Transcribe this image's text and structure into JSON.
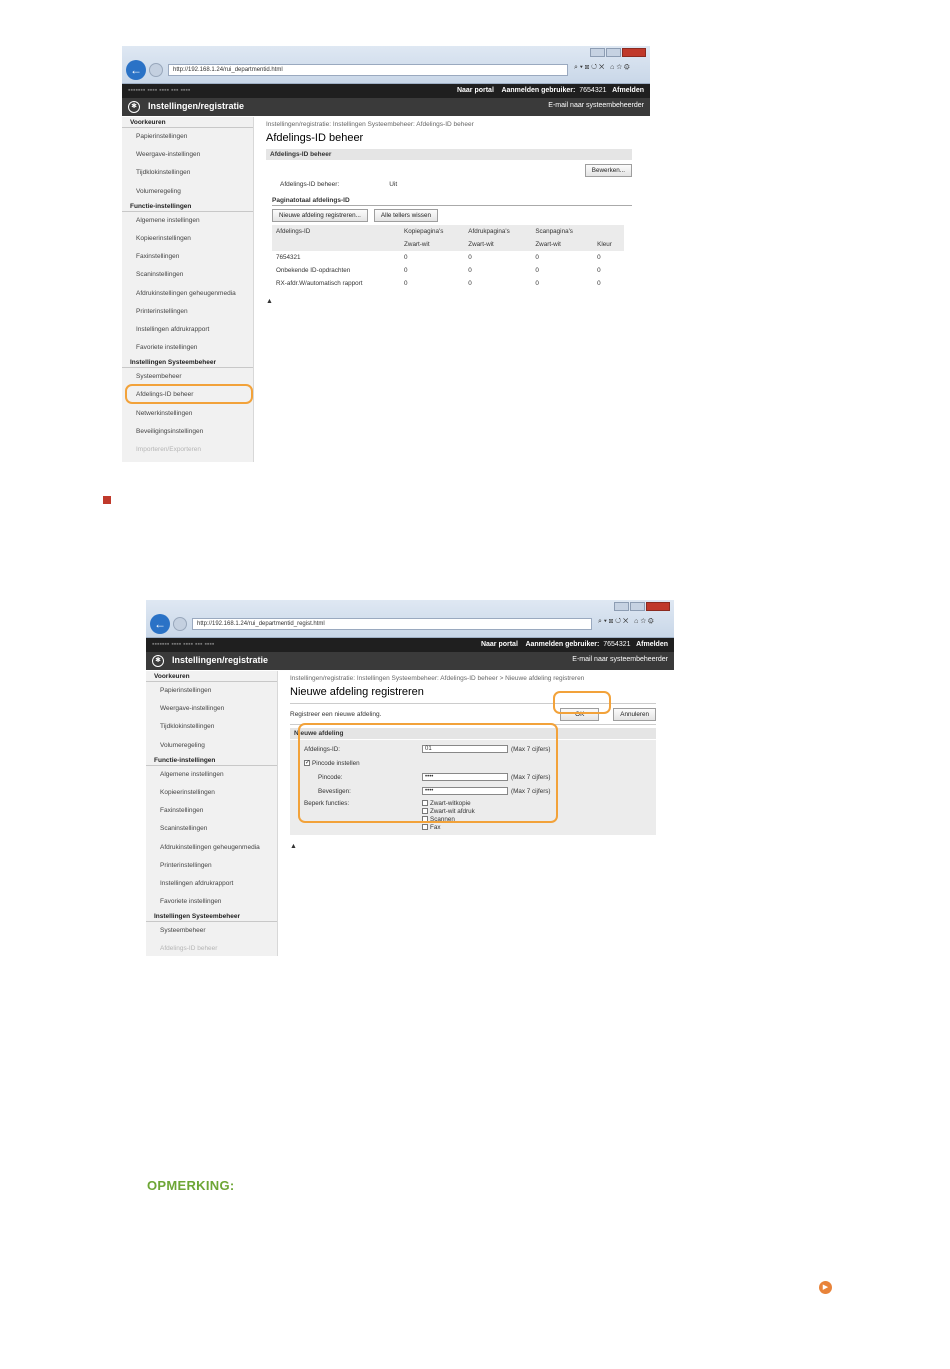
{
  "screenshot1": {
    "url": "http://192.168.1.24/rui_departmentid.html",
    "topbar": {
      "portal": "Naar portal",
      "login_label": "Aanmelden gebruiker:",
      "login_user": "7654321",
      "logout": "Afmelden"
    },
    "header": {
      "title": "Instellingen/registratie",
      "mail": "E-mail naar systeembeheerder"
    },
    "sidebar": [
      {
        "t": "Voorkeuren",
        "h": true
      },
      {
        "t": "Papierinstellingen"
      },
      {
        "t": "Weergave-instellingen"
      },
      {
        "t": "Tijdklokinstellingen"
      },
      {
        "t": "Volumeregeling"
      },
      {
        "t": "Functie-instellingen",
        "h": true
      },
      {
        "t": "Algemene instellingen"
      },
      {
        "t": "Kopieerinstellingen"
      },
      {
        "t": "Faxinstellingen"
      },
      {
        "t": "Scaninstellingen"
      },
      {
        "t": "Afdrukinstellingen geheugenmedia"
      },
      {
        "t": "Printerinstellingen"
      },
      {
        "t": "Instellingen afdrukrapport"
      },
      {
        "t": "Favoriete instellingen"
      },
      {
        "t": "Instellingen Systeembeheer",
        "h": true
      },
      {
        "t": "Systeembeheer"
      },
      {
        "t": "Afdelings-ID beheer"
      },
      {
        "t": "Netwerkinstellingen"
      },
      {
        "t": "Beveiligingsinstellingen"
      },
      {
        "t": "Importeren/Exporteren"
      }
    ],
    "breadcrumb": "Instellingen/registratie: Instellingen Systeembeheer: Afdelings-ID beheer",
    "page_title": "Afdelings-ID beheer",
    "section_title": "Afdelings-ID beheer",
    "edit_button": "Bewerken...",
    "status_label": "Afdelings-ID beheer:",
    "status_value": "Uit",
    "subsection_title": "Paginatotaal afdelings-ID",
    "register_button": "Nieuwe afdeling registreren...",
    "clear_button": "Alle tellers wissen",
    "table_head1": [
      "Afdelings-ID",
      "Kopiepagina's",
      "Afdrukpagina's",
      "Scanpagina's",
      ""
    ],
    "table_head2": [
      "",
      "Zwart-wit",
      "Zwart-wit",
      "Zwart-wit",
      "Kleur"
    ],
    "rows": [
      [
        "7654321",
        "0",
        "0",
        "0",
        "0"
      ],
      [
        "Onbekende ID-opdrachten",
        "0",
        "0",
        "0",
        "0"
      ],
      [
        "RX-afdr.W/automatisch rapport",
        "0",
        "0",
        "0",
        "0"
      ]
    ],
    "top_icon": "▲"
  },
  "screenshot2": {
    "url": "http://192.168.1.24/rui_departmentid_regist.html",
    "topbar": {
      "portal": "Naar portal",
      "login_label": "Aanmelden gebruiker:",
      "login_user": "7654321",
      "logout": "Afmelden"
    },
    "header": {
      "title": "Instellingen/registratie",
      "mail": "E-mail naar systeembeheerder"
    },
    "sidebar": [
      {
        "t": "Voorkeuren",
        "h": true
      },
      {
        "t": "Papierinstellingen"
      },
      {
        "t": "Weergave-instellingen"
      },
      {
        "t": "Tijdklokinstellingen"
      },
      {
        "t": "Volumeregeling"
      },
      {
        "t": "Functie-instellingen",
        "h": true
      },
      {
        "t": "Algemene instellingen"
      },
      {
        "t": "Kopieerinstellingen"
      },
      {
        "t": "Faxinstellingen"
      },
      {
        "t": "Scaninstellingen"
      },
      {
        "t": "Afdrukinstellingen geheugenmedia"
      },
      {
        "t": "Printerinstellingen"
      },
      {
        "t": "Instellingen afdrukrapport"
      },
      {
        "t": "Favoriete instellingen"
      },
      {
        "t": "Instellingen Systeembeheer",
        "h": true
      },
      {
        "t": "Systeembeheer"
      },
      {
        "t": "Afdelings-ID beheer"
      }
    ],
    "breadcrumb": "Instellingen/registratie: Instellingen Systeembeheer: Afdelings-ID beheer > Nieuwe afdeling registreren",
    "page_title": "Nieuwe afdeling registreren",
    "intro": "Registreer een nieuwe afdeling.",
    "ok_button": "OK",
    "cancel_button": "Annuleren",
    "section_title": "Nieuwe afdeling",
    "id_label": "Afdelings-ID:",
    "id_value": "01",
    "id_hint": "(Max 7 cijfers)",
    "pin_check_label": "Pincode instellen",
    "pin_label": "Pincode:",
    "pin_value": "••••",
    "pin_hint": "(Max 7 cijfers)",
    "confirm_label": "Bevestigen:",
    "confirm_value": "••••",
    "confirm_hint": "(Max 7 cijfers)",
    "restrict_label": "Beperk functies:",
    "restrict_options": [
      "Zwart-witkopie",
      "Zwart-wit afdruk",
      "Scannen",
      "Fax"
    ],
    "top_icon": "▲"
  },
  "note_heading": "OPMERKING:",
  "next_icon": "▶"
}
